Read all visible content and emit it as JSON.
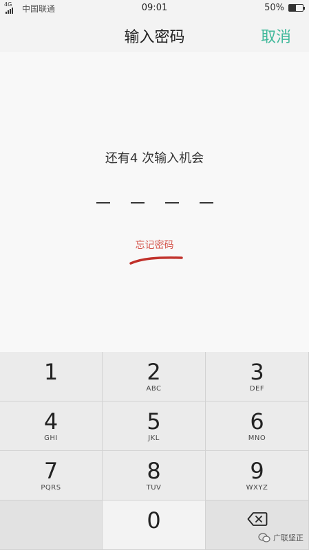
{
  "status_bar": {
    "network": "4G",
    "carrier": "中国联通",
    "time": "09:01",
    "battery_percent": "50%",
    "battery_level": 0.5
  },
  "nav": {
    "title": "输入密码",
    "cancel_label": "取消"
  },
  "prompt": {
    "attempts_text": "还有4 次输入机会",
    "forgot_label": "忘记密码"
  },
  "pin": {
    "length": 4,
    "entered": 0
  },
  "keypad": {
    "keys": [
      {
        "digit": "1",
        "letters": ""
      },
      {
        "digit": "2",
        "letters": "ABC"
      },
      {
        "digit": "3",
        "letters": "DEF"
      },
      {
        "digit": "4",
        "letters": "GHI"
      },
      {
        "digit": "5",
        "letters": "JKL"
      },
      {
        "digit": "6",
        "letters": "MNO"
      },
      {
        "digit": "7",
        "letters": "PQRS"
      },
      {
        "digit": "8",
        "letters": "TUV"
      },
      {
        "digit": "9",
        "letters": "WXYZ"
      },
      {
        "digit": "0",
        "letters": ""
      }
    ],
    "delete_icon": "backspace-icon"
  },
  "watermark": {
    "text": "广联坚正"
  },
  "colors": {
    "accent": "#3fb89a",
    "forgot": "#d4564d",
    "annotation": "#c0302a"
  }
}
